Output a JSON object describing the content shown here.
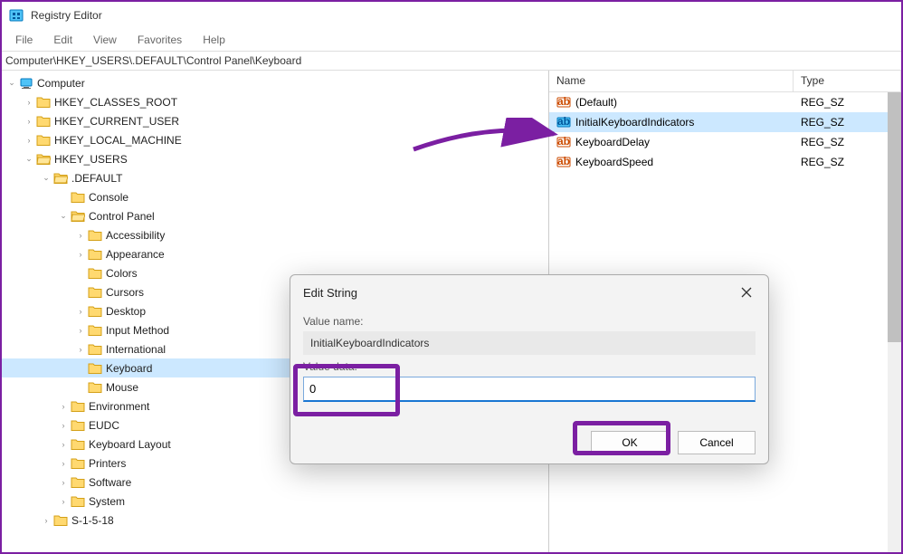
{
  "app": {
    "title": "Registry Editor"
  },
  "menu": {
    "items": [
      "File",
      "Edit",
      "View",
      "Favorites",
      "Help"
    ]
  },
  "address": {
    "path": "Computer\\HKEY_USERS\\.DEFAULT\\Control Panel\\Keyboard"
  },
  "tree": {
    "root": "Computer",
    "hives": [
      "HKEY_CLASSES_ROOT",
      "HKEY_CURRENT_USER",
      "HKEY_LOCAL_MACHINE",
      "HKEY_USERS"
    ],
    "hkey_users": {
      "children": [
        ".DEFAULT",
        "S-1-5-18"
      ],
      "default_children": [
        "Console",
        "Control Panel",
        "Environment",
        "EUDC",
        "Keyboard Layout",
        "Printers",
        "Software",
        "System"
      ],
      "control_panel_children": [
        "Accessibility",
        "Appearance",
        "Colors",
        "Cursors",
        "Desktop",
        "Input Method",
        "International",
        "Keyboard",
        "Mouse"
      ]
    }
  },
  "list": {
    "columns": {
      "name": "Name",
      "type": "Type"
    },
    "rows": [
      {
        "name": "(Default)",
        "type": "REG_SZ"
      },
      {
        "name": "InitialKeyboardIndicators",
        "type": "REG_SZ"
      },
      {
        "name": "KeyboardDelay",
        "type": "REG_SZ"
      },
      {
        "name": "KeyboardSpeed",
        "type": "REG_SZ"
      }
    ]
  },
  "dialog": {
    "title": "Edit String",
    "value_name_label": "Value name:",
    "value_name": "InitialKeyboardIndicators",
    "value_data_label": "Value data:",
    "value_data": "0",
    "ok": "OK",
    "cancel": "Cancel"
  }
}
